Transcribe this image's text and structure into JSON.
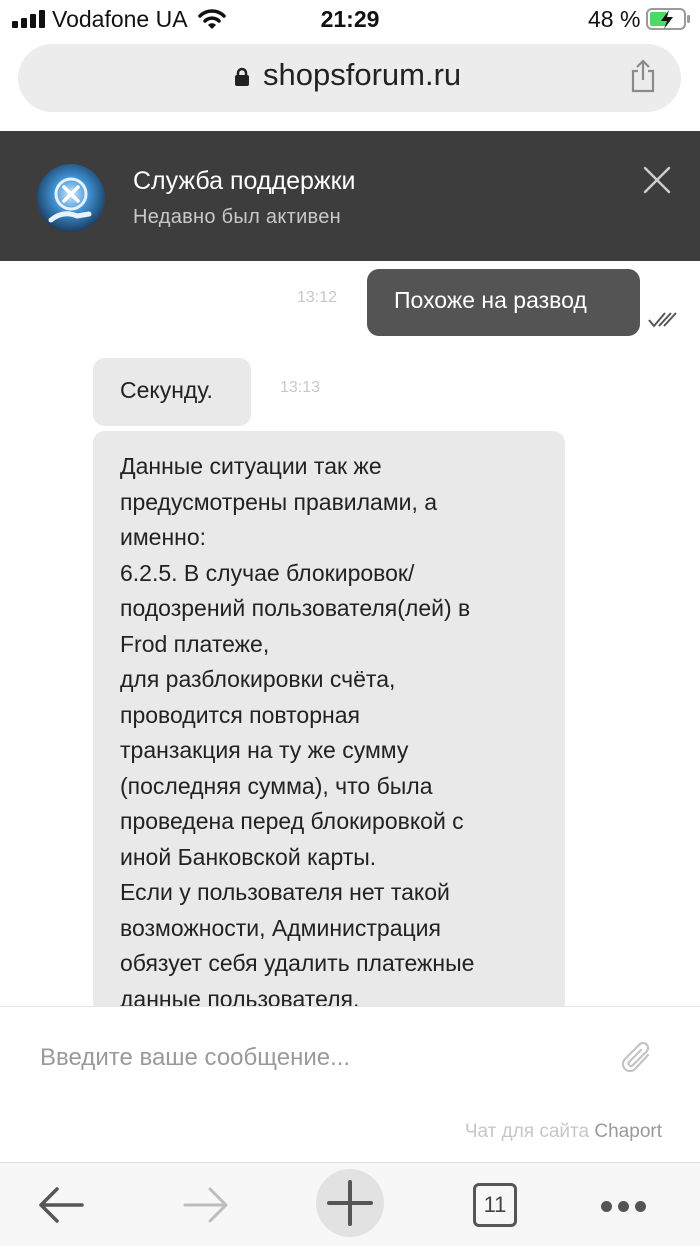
{
  "status_bar": {
    "carrier": "Vodafone UA",
    "time": "21:29",
    "battery_percent": "48 %",
    "icons": [
      "signal-icon",
      "wifi-icon",
      "battery-charging-icon"
    ]
  },
  "browser": {
    "url": "shopsforum.ru",
    "icons": [
      "lock-icon",
      "share-icon"
    ]
  },
  "chat_header": {
    "title": "Служба поддержки",
    "subtitle": "Недавно был активен",
    "icons": [
      "support-avatar",
      "close-icon"
    ]
  },
  "messages": [
    {
      "direction": "out",
      "time": "13:12",
      "text": "Похоже на развод",
      "status_icon": "double-check-icon"
    },
    {
      "direction": "in",
      "time": "13:13",
      "text": "Секунду."
    },
    {
      "direction": "in",
      "lines": [
        "Данные ситуации так же",
        "предусмотрены правилами, а",
        "именно:",
        "6.2.5. В случае блокировок/",
        "подозрений пользователя(лей) в",
        "Frod платеже,",
        "для разблокировки счёта,",
        "проводится повторная",
        "транзакция на ту же сумму",
        "(последняя сумма), что была",
        "проведена перед блокировкой с",
        "иной Банковской карты.",
        "Если у пользователя нет такой",
        "возможности, Администрация",
        "обязует себя удалить платежные",
        "данные пользователя,"
      ]
    }
  ],
  "composer": {
    "placeholder": "Введите ваше сообщение...",
    "branding_prefix": "Чат для сайта",
    "branding_name": "Chaport",
    "icons": [
      "paperclip-icon"
    ]
  },
  "toolbar": {
    "tab_count": "11",
    "icons": [
      "back-arrow-icon",
      "forward-arrow-icon",
      "plus-icon",
      "tabs-icon",
      "more-icon"
    ]
  },
  "colors": {
    "header_bg": "#3d3d3d",
    "outgoing_bubble": "#545454",
    "incoming_bubble": "#e9e9e9",
    "address_bar_bg": "#ececec",
    "battery_green": "#4cd964"
  }
}
